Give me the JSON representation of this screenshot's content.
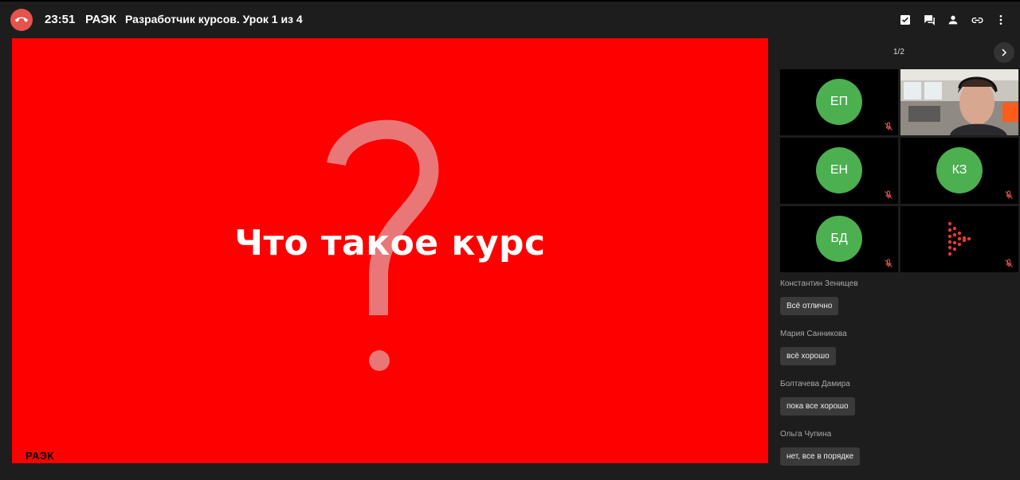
{
  "header": {
    "time": "23:51",
    "org": "РАЭК",
    "title": "Разработчик курсов. Урок 1 из 4"
  },
  "slide": {
    "title": "Что такое курс",
    "logo": "РАЭК",
    "background": "#ff0000"
  },
  "participants": {
    "page_indicator": "1/2",
    "tiles": [
      {
        "initials": "ЕП"
      },
      {
        "initials": "ЕН"
      },
      {
        "initials": "КЗ"
      },
      {
        "initials": "БД"
      }
    ]
  },
  "chat": {
    "messages": [
      {
        "author": "Константин Зенищев",
        "text": "Всё отлично"
      },
      {
        "author": "Мария Санникова",
        "text": "всё хорошо"
      },
      {
        "author": "Болтачева Дамира",
        "text": "пока все хорошо"
      },
      {
        "author": "Ольга Чупина",
        "text": "нет, все в порядке"
      }
    ]
  },
  "colors": {
    "accent_red": "#e5534b",
    "avatar_green": "#4caf50",
    "mic_off": "#e5534b"
  }
}
